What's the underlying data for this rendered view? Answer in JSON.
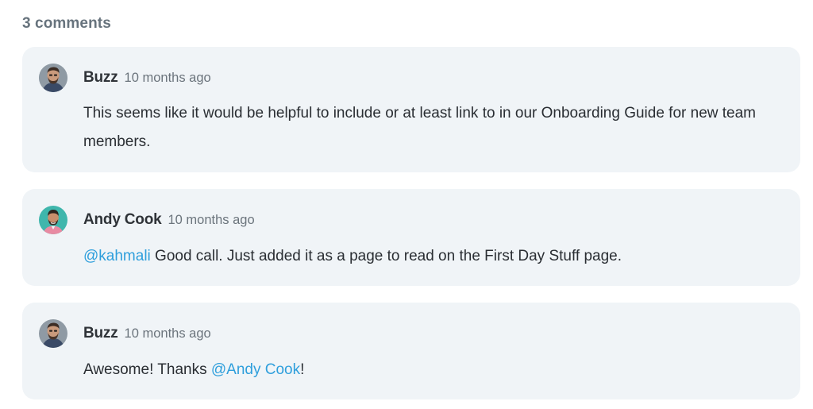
{
  "comments_count_label": "3 comments",
  "colors": {
    "card_bg": "#f0f4f7",
    "mention": "#2f9fdc",
    "heading": "#67737d"
  },
  "comments": [
    {
      "author": "Buzz",
      "time": "10 months ago",
      "avatar_icon": "buzz-avatar",
      "body": "This seems like it would be helpful to include or at least link to in our Onboarding Guide for new team members."
    },
    {
      "author": "Andy Cook",
      "time": "10 months ago",
      "avatar_icon": "andy-cook-avatar",
      "mention": "@kahmali",
      "body_after": " Good call. Just added it as a page to read on the First Day Stuff page."
    },
    {
      "author": "Buzz",
      "time": "10 months ago",
      "avatar_icon": "buzz-avatar",
      "body_before": "Awesome! Thanks ",
      "mention": "@Andy Cook",
      "body_after": "!"
    }
  ]
}
